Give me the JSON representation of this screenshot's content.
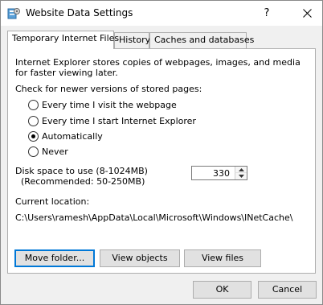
{
  "window": {
    "title": "Website Data Settings",
    "help_symbol": "?",
    "close_icon": "close-icon"
  },
  "tabs": [
    {
      "label": "Temporary Internet Files",
      "active": true
    },
    {
      "label": "History",
      "active": false
    },
    {
      "label": "Caches and databases",
      "active": false
    }
  ],
  "panel": {
    "description_line1": "Internet Explorer stores copies of webpages, images, and media",
    "description_line2": "for faster viewing later.",
    "check_heading": "Check for newer versions of stored pages:",
    "options": [
      {
        "label": "Every time I visit the webpage",
        "checked": false
      },
      {
        "label": "Every time I start Internet Explorer",
        "checked": false
      },
      {
        "label": "Automatically",
        "checked": true
      },
      {
        "label": "Never",
        "checked": false
      }
    ],
    "disk_space_label1": "Disk space to use (8-1024MB)",
    "disk_space_label2": "(Recommended: 50-250MB)",
    "disk_space_value": "330",
    "current_location_label": "Current location:",
    "current_location_path": "C:\\Users\\ramesh\\AppData\\Local\\Microsoft\\Windows\\INetCache\\",
    "buttons": {
      "move_folder": "Move folder...",
      "view_objects": "View objects",
      "view_files": "View files"
    }
  },
  "footer": {
    "ok": "OK",
    "cancel": "Cancel"
  },
  "colors": {
    "accent": "#0078d7",
    "button_face": "#e1e1e1",
    "dialog_bg": "#f0f0f0"
  }
}
